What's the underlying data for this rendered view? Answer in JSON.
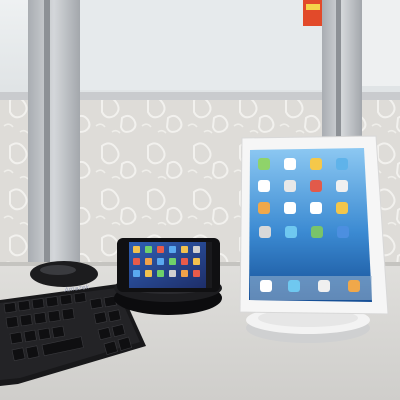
{
  "scene": {
    "keyboard_brand_text": "Amazek",
    "objects": [
      {
        "name": "cubicle-partition-wall",
        "color": "#e2e1dd"
      },
      {
        "name": "frosted-glass-panel",
        "color": "#e8ecee"
      },
      {
        "name": "aluminum-frame",
        "color": "#b9bcc0"
      },
      {
        "name": "black-keyboard",
        "color": "#1a1a1c"
      },
      {
        "name": "black-mouse",
        "color": "#1c1c1e"
      },
      {
        "name": "smartphone-on-dock",
        "color": "#101012"
      },
      {
        "name": "white-tablet-on-stand",
        "color": "#f4f4f4"
      }
    ],
    "colors": {
      "desk": "#d9d8d5",
      "tablet_screen_top": "#7fc1f0",
      "tablet_screen_bottom": "#1a5fa8",
      "phone_screen": "#2a3f8a",
      "sticky_note": "#e24a2a"
    }
  }
}
